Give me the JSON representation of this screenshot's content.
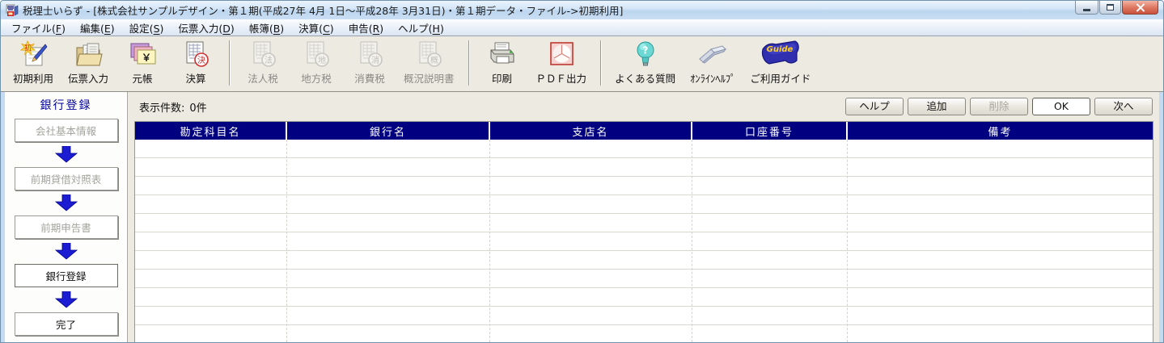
{
  "window": {
    "app_name": "税理士いらず",
    "title": "税理士いらず - [株式会社サンプルデザイン・第１期(平成27年 4月 1日～平成28年 3月31日)・第１期データ・ファイル->初期利用]"
  },
  "menu": {
    "items": [
      {
        "pre": "ファイル(",
        "key": "F",
        "post": ")"
      },
      {
        "pre": "編集(",
        "key": "E",
        "post": ")"
      },
      {
        "pre": "設定(",
        "key": "S",
        "post": ")"
      },
      {
        "pre": "伝票入力(",
        "key": "D",
        "post": ")"
      },
      {
        "pre": "帳簿(",
        "key": "B",
        "post": ")"
      },
      {
        "pre": "決算(",
        "key": "C",
        "post": ")"
      },
      {
        "pre": "申告(",
        "key": "R",
        "post": ")"
      },
      {
        "pre": "ヘルプ(",
        "key": "H",
        "post": ")"
      }
    ]
  },
  "toolbar": {
    "items": [
      {
        "label": "初期利用",
        "icon_text": "初",
        "enabled": true
      },
      {
        "label": "伝票入力",
        "enabled": true
      },
      {
        "label": "元帳",
        "icon_text": "￥",
        "enabled": true
      },
      {
        "label": "決算",
        "icon_text": "決",
        "enabled": true
      },
      {
        "label": "法人税",
        "icon_text": "法",
        "enabled": false
      },
      {
        "label": "地方税",
        "icon_text": "地",
        "enabled": false
      },
      {
        "label": "消費税",
        "icon_text": "消",
        "enabled": false
      },
      {
        "label": "概況説明書",
        "icon_text": "概",
        "enabled": false
      },
      {
        "label": "印刷",
        "enabled": true
      },
      {
        "label": "ＰＤＦ出力",
        "enabled": true
      },
      {
        "label": "よくある質問",
        "icon_text": "?",
        "enabled": true
      },
      {
        "label": "ｵﾝﾗｲﾝﾍﾙﾌﾟ",
        "enabled": true
      },
      {
        "label": "ご利用ガイド",
        "icon_text": "Guide",
        "enabled": true
      }
    ]
  },
  "sidebar": {
    "title": "銀行登録",
    "steps": [
      {
        "label": "会社基本情報",
        "state": "disabled"
      },
      {
        "label": "前期貸借対照表",
        "state": "disabled"
      },
      {
        "label": "前期申告書",
        "state": "disabled"
      },
      {
        "label": "銀行登録",
        "state": "active"
      },
      {
        "label": "完了",
        "state": "normal"
      }
    ]
  },
  "content": {
    "count_label": "表示件数:",
    "count_value": "0件",
    "actions": [
      {
        "label": "ヘルプ",
        "state": "normal"
      },
      {
        "label": "追加",
        "state": "normal"
      },
      {
        "label": "削除",
        "state": "disabled"
      },
      {
        "label": "OK",
        "state": "default"
      },
      {
        "label": "次へ",
        "state": "normal"
      }
    ],
    "table": {
      "columns": [
        "勘定科目名",
        "銀行名",
        "支店名",
        "口座番号",
        "備考"
      ]
    }
  },
  "colors": {
    "table_header_bg": "#000080",
    "table_header_text": "#ffffff",
    "sidebar_title_text": "#000099",
    "step_arrow_blue": "#1c1cd2",
    "close_button_red": "#c8523c",
    "toolbar_bg": "#edeae1"
  }
}
